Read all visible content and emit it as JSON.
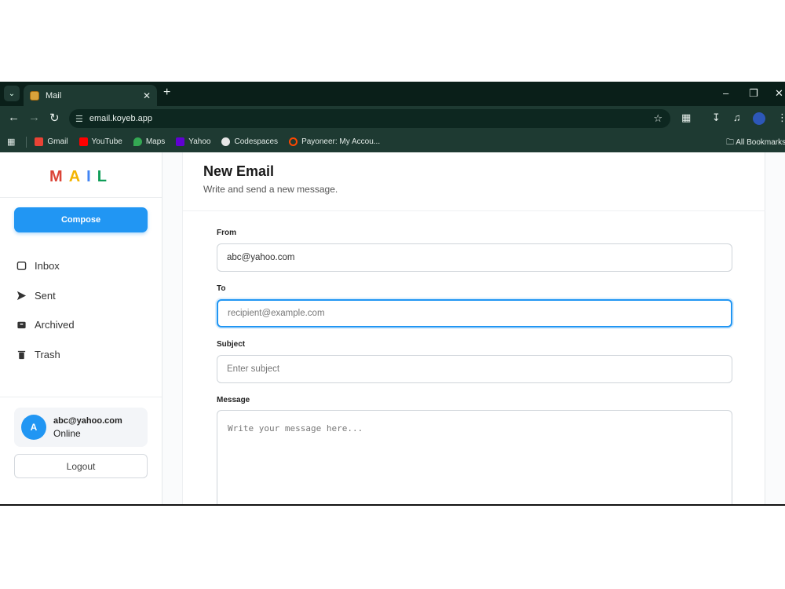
{
  "browser": {
    "tab_title": "Mail",
    "url": "email.koyeb.app",
    "bookmarks": [
      {
        "label": "Gmail",
        "color": "#ea4335"
      },
      {
        "label": "YouTube",
        "color": "#ff0000"
      },
      {
        "label": "Maps",
        "color": "#34a853"
      },
      {
        "label": "Yahoo",
        "color": "#6001d2"
      },
      {
        "label": "Codespaces",
        "color": "#e6e6e6"
      },
      {
        "label": "Payoneer: My Accou...",
        "color": "#ff4800"
      }
    ],
    "all_bookmarks": "All Bookmarks"
  },
  "sidebar": {
    "logo": [
      "M",
      "A",
      "I",
      "L"
    ],
    "compose_label": "Compose",
    "nav": [
      {
        "label": "Inbox",
        "icon": "inbox-icon"
      },
      {
        "label": "Sent",
        "icon": "send-icon"
      },
      {
        "label": "Archived",
        "icon": "archive-icon"
      },
      {
        "label": "Trash",
        "icon": "trash-icon"
      }
    ],
    "user": {
      "avatar_letter": "A",
      "email": "abc@yahoo.com",
      "status": "Online"
    },
    "logout_label": "Logout"
  },
  "main": {
    "title": "New Email",
    "subtitle": "Write and send a new message.",
    "from": {
      "label": "From",
      "value": "abc@yahoo.com"
    },
    "to": {
      "label": "To",
      "placeholder": "recipient@example.com"
    },
    "subject": {
      "label": "Subject",
      "placeholder": "Enter subject"
    },
    "message": {
      "label": "Message",
      "placeholder": "Write your message here..."
    }
  },
  "colors": {
    "accent": "#2196f3",
    "chrome_bg": "#1e3a32"
  }
}
